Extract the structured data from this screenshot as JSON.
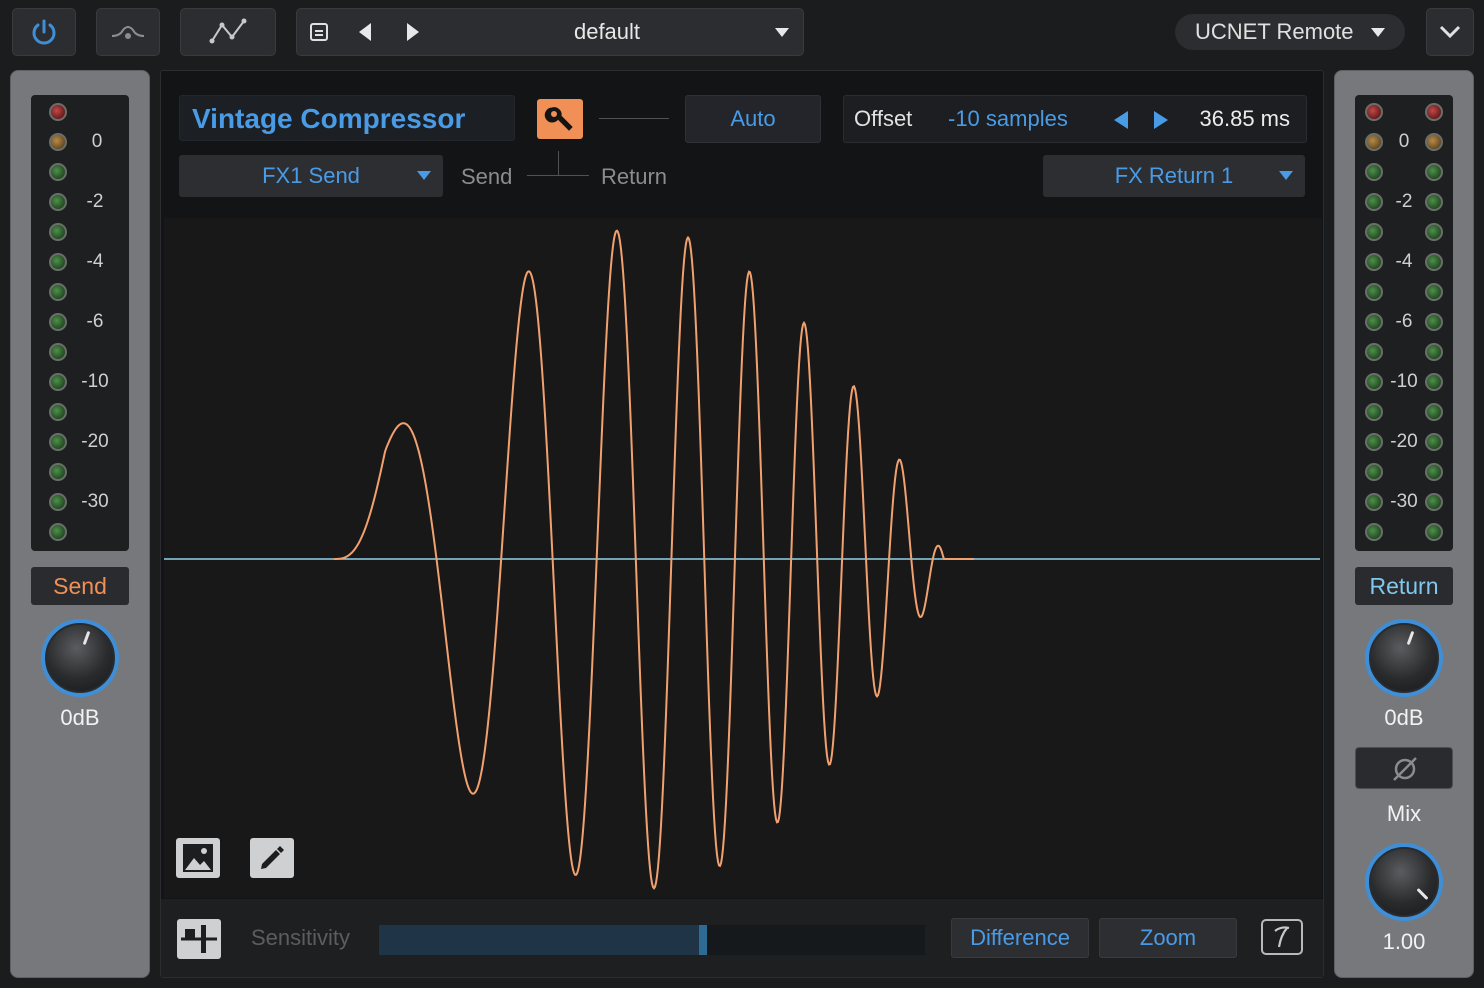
{
  "topbar": {
    "preset_name": "default",
    "remote_label": "UCNET Remote",
    "icons": [
      "power-icon",
      "ab-compare-icon",
      "automation-icon",
      "save-preset-icon",
      "previous-preset-icon",
      "next-preset-icon",
      "expand-icon"
    ]
  },
  "send_panel": {
    "label": "Send",
    "value": "0dB",
    "meter_scale": [
      "0",
      "-2",
      "-4",
      "-6",
      "-10",
      "-20",
      "-30"
    ]
  },
  "return_panel": {
    "label": "Return",
    "value": "0dB",
    "mix_label": "Mix",
    "mix_value": "1.00",
    "meter_scale": [
      "0",
      "-2",
      "-4",
      "-6",
      "-10",
      "-20",
      "-30"
    ]
  },
  "main": {
    "plugin_name": "Vintage Compressor",
    "auto_label": "Auto",
    "offset_label": "Offset",
    "offset_samples": "-10 samples",
    "offset_ms": "36.85 ms",
    "send_dropdown": "FX1 Send",
    "return_dropdown": "FX Return 1",
    "routing_send": "Send",
    "routing_return": "Return"
  },
  "bottom": {
    "sensitivity_label": "Sensitivity",
    "sensitivity_level": 0.6,
    "difference_label": "Difference",
    "zoom_label": "Zoom"
  },
  "colors": {
    "accent_blue": "#4a9be6",
    "waveform_orange": "#f1a170",
    "baseline_cyan": "#8fd3ea",
    "send_orange": "#f08f56",
    "return_blue": "#7fc8ee"
  }
}
